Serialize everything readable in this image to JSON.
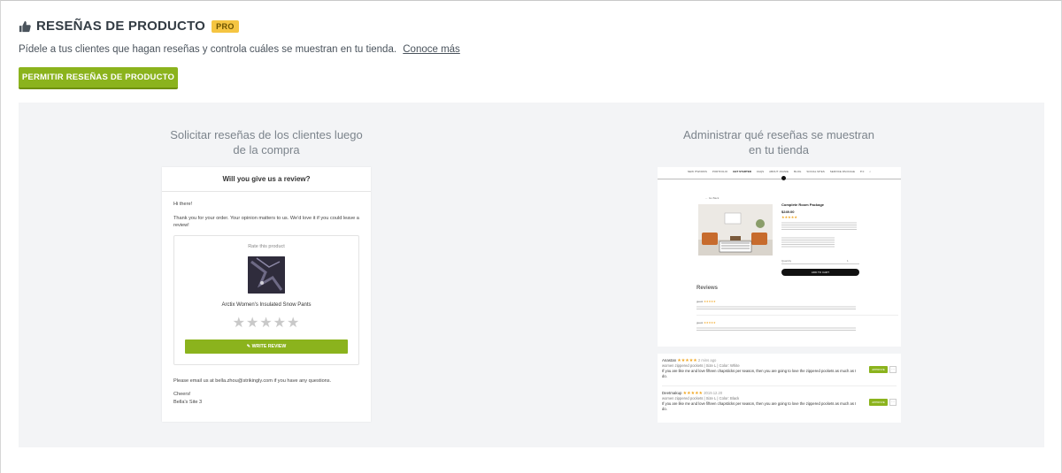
{
  "header": {
    "title": "RESEÑAS DE PRODUCTO",
    "badge": "PRO",
    "icon": "thumbs-up-icon"
  },
  "description": {
    "text": "Pídele a tus clientes que hagan reseñas y controla cuáles se muestran en tu tienda.",
    "link": "Conoce más"
  },
  "enable_button": "PERMITIR RESEÑAS DE PRODUCTO",
  "left_column": {
    "title_line1": "Solicitar reseñas de los clientes luego",
    "title_line2": "de la compra",
    "email": {
      "heading": "Will you give us a review?",
      "greeting": "Hi there!",
      "message": "Thank you for your order. Your opinion matters to us. We'd love it if you could leave a review!",
      "rate_label": "Rate this product",
      "product_name": "Arctix Women's Insulated Snow Pants",
      "stars": "★★★★★",
      "write_button": "WRITE REVIEW",
      "footer_line": "Please email us at bella.zhou@strikingly.com if you have any questions.",
      "signoff": "Cheers!",
      "signature": "Bella's Site 3"
    }
  },
  "right_column": {
    "title_line1": "Administrar qué reseñas se muestran",
    "title_line2": "en tu tienda",
    "shop": {
      "nav": [
        "NEW ITWORKS",
        "PORTFOLIO",
        "GET STARTED",
        "FAQS",
        "ABOUT JOANIE",
        "BLOG",
        "SOCIAL SITES",
        "SERVICE PACKAGE",
        "♥ 0",
        "⌕"
      ],
      "back": "← Go Back",
      "product_title": "Complete Room Package",
      "price": "$249.00",
      "reviews_heading": "Reviews",
      "add_to_cart": "ADD TO CART",
      "quantity_label": "Quantity",
      "quantity_value": "1"
    },
    "reviews": [
      {
        "name": "Anastan",
        "stars": "★★★★★",
        "date": "2 mins ago",
        "meta": "women zippered pockets  |  Size L  |  Color: White",
        "text": "If you are like me and love fifteen chapsticks per season, then you are going to love the zippered pockets as much as I do.",
        "approve": "APPROVE",
        "more": "···"
      },
      {
        "name": "Deetmakup",
        "stars": "★★★★★",
        "date": "2019.12.20",
        "meta": "women zippered pockets  |  Size L  |  Color: Black",
        "text": "If you are like me and love fifteen chapsticks per season, then you are going to love the zippered pockets as much as I do.",
        "approve": "APPROVE",
        "more": "···"
      }
    ]
  }
}
